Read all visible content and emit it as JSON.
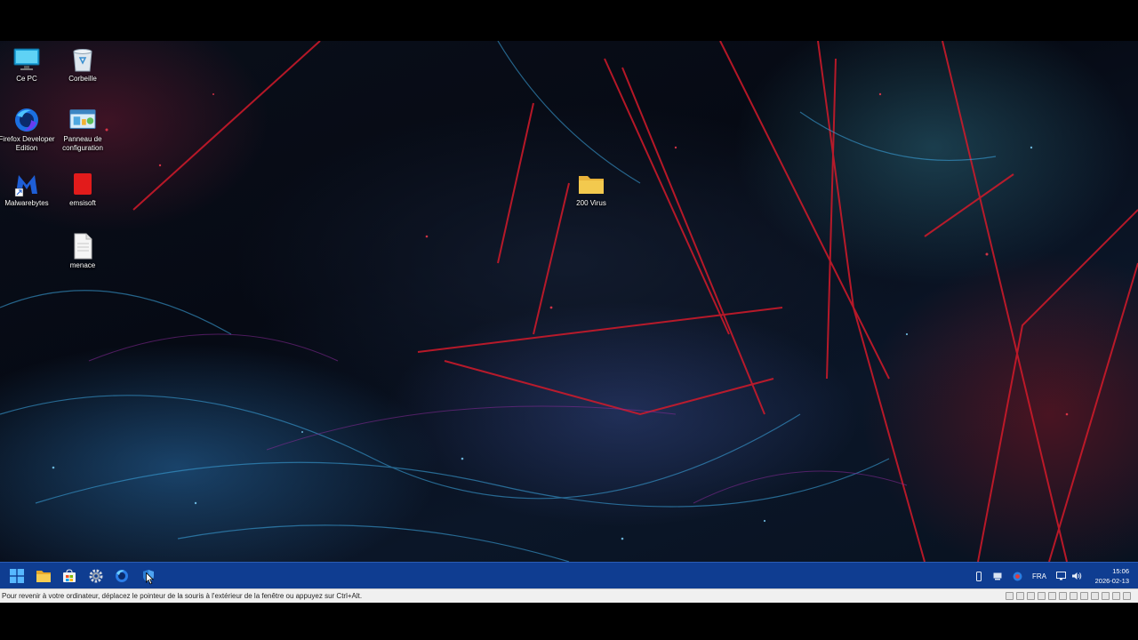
{
  "desktop": {
    "icons": [
      {
        "label": "Ce PC",
        "icon": "monitor-icon"
      },
      {
        "label": "Corbeille",
        "icon": "recycle-bin-icon"
      },
      {
        "label": "Firefox Developer Edition",
        "icon": "firefox-developer-icon"
      },
      {
        "label": "Panneau de configuration",
        "icon": "control-panel-icon"
      },
      {
        "label": "Malwarebytes",
        "icon": "malwarebytes-icon"
      },
      {
        "label": "emsisoft",
        "icon": "emsisoft-icon"
      },
      {
        "label": "menace",
        "icon": "text-file-icon"
      },
      {
        "label": "200 Virus",
        "icon": "folder-icon"
      }
    ]
  },
  "taskbar": {
    "pinned": [
      "windows-start-icon",
      "file-explorer-icon",
      "microsoft-store-icon",
      "settings-gear-icon",
      "firefox-developer-icon",
      "windows-security-icon"
    ],
    "tray": {
      "language": "FRA",
      "time": "15:06",
      "date": "2026-02-13"
    }
  },
  "vm_status": {
    "message": "Pour revenir à votre ordinateur, déplacez le pointeur de la souris à l'extérieur de la fenêtre ou appuyez sur Ctrl+Alt."
  },
  "colors": {
    "taskbar": "#0f3d91",
    "folder": "#f3c94e"
  }
}
